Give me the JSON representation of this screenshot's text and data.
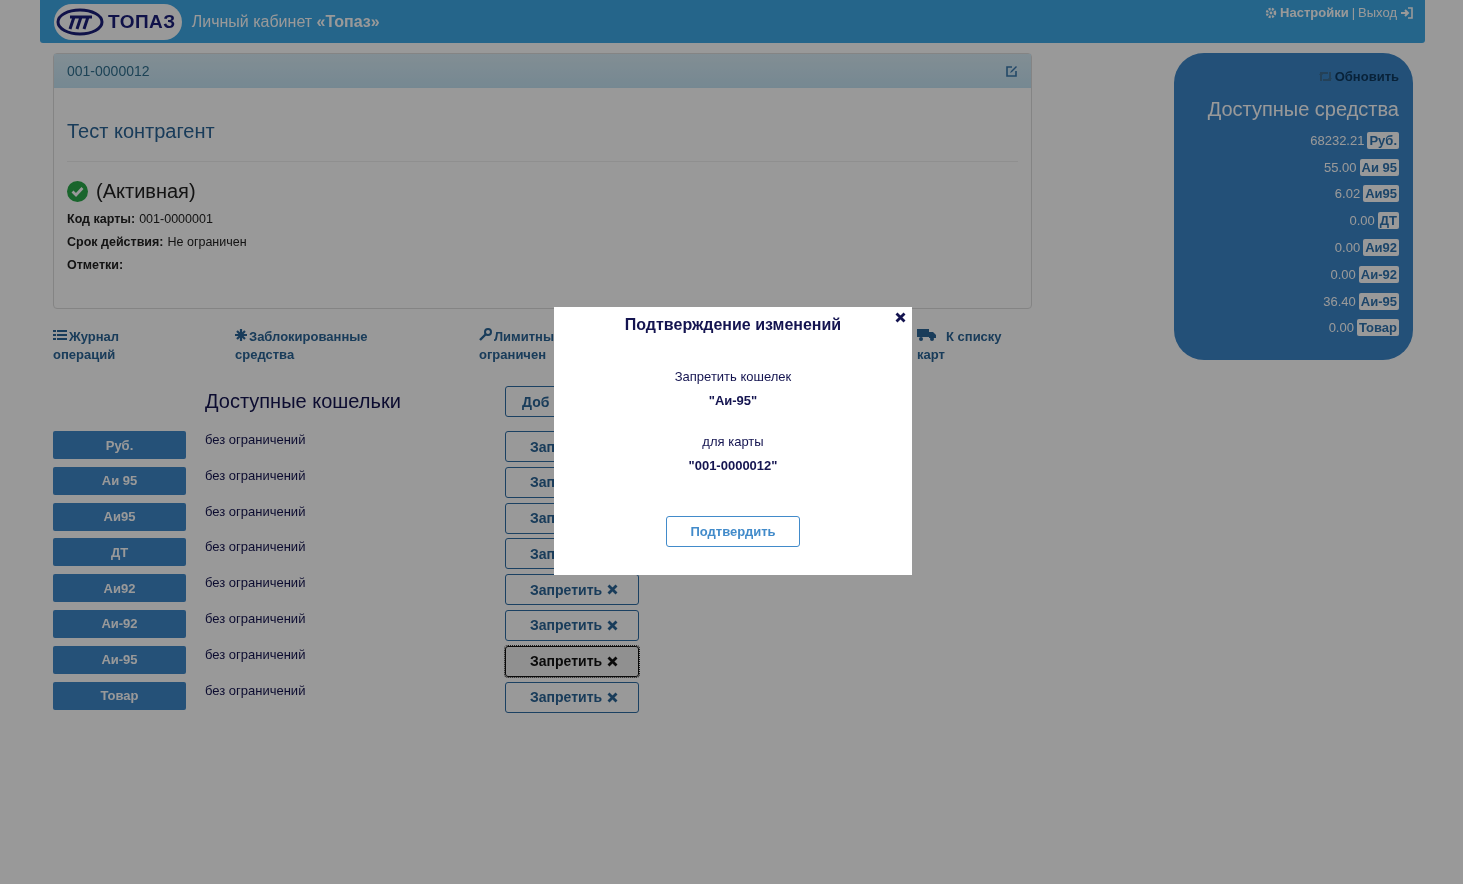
{
  "header": {
    "logo_text": "ТОПАЗ",
    "title_plain": "Личный кабинет ",
    "title_bold": "«Топаз»",
    "settings": "Настройки",
    "separator": "|",
    "logout": "Выход"
  },
  "card": {
    "number": "001-0000012",
    "contractor": "Тест контрагент",
    "status": "(Активная)",
    "active": true,
    "fields": [
      {
        "label": "Код карты:",
        "value": "001-0000001"
      },
      {
        "label": "Срок действия:",
        "value": "Не ограничен"
      },
      {
        "label": "Отметки:"
      }
    ]
  },
  "nav": [
    {
      "kind": "list",
      "lines": [
        "Журнал",
        "операций"
      ]
    },
    {
      "kind": "asterisk",
      "lines": [
        "Заблокированные",
        "средства"
      ]
    },
    {
      "kind": "wrench",
      "lines": [
        "Лимитны",
        "ограничен"
      ]
    },
    {
      "kind": "truck",
      "lines": [
        "К списку",
        "карт"
      ]
    }
  ],
  "wallets": {
    "title": "Доступные кошельки",
    "add_button": "Доб",
    "rows": [
      {
        "name": "Руб.",
        "limit": "без ограничений",
        "button": "Зап",
        "focused": false,
        "icon": false
      },
      {
        "name": "Аи 95",
        "limit": "без ограничений",
        "button": "Зап",
        "focused": false,
        "icon": false
      },
      {
        "name": "Аи95",
        "limit": "без ограничений",
        "button": "Зап",
        "focused": false,
        "icon": false
      },
      {
        "name": "ДТ",
        "limit": "без ограничений",
        "button": "Зап",
        "focused": false,
        "icon": false
      },
      {
        "name": "Аи92",
        "limit": "без ограничений",
        "button": "Запретить",
        "focused": false,
        "icon": true
      },
      {
        "name": "Аи-92",
        "limit": "без ограничений",
        "button": "Запретить",
        "focused": false,
        "icon": true
      },
      {
        "name": "Аи-95",
        "limit": "без ограничений",
        "button": "Запретить",
        "focused": true,
        "icon": true
      },
      {
        "name": "Товар",
        "limit": "без ограничений",
        "button": "Запретить",
        "focused": false,
        "icon": true
      }
    ]
  },
  "funds": {
    "refresh": "Обновить",
    "title": "Доступные средства",
    "items": [
      {
        "amount": "68232.21",
        "unit": "Руб."
      },
      {
        "amount": "55.00",
        "unit": "Аи 95"
      },
      {
        "amount": "6.02",
        "unit": "Аи95"
      },
      {
        "amount": "0.00",
        "unit": "ДТ"
      },
      {
        "amount": "0.00",
        "unit": "Аи92"
      },
      {
        "amount": "0.00",
        "unit": "Аи-92"
      },
      {
        "amount": "36.40",
        "unit": "Аи-95"
      },
      {
        "amount": "0.00",
        "unit": "Товар"
      }
    ]
  },
  "modal": {
    "title": "Подтверждение изменений",
    "line1": "Запретить кошелек",
    "wallet": "\"Аи-95\"",
    "line2": "для карты",
    "card": "\"001-0000012\"",
    "confirm": "Подтвердить"
  }
}
